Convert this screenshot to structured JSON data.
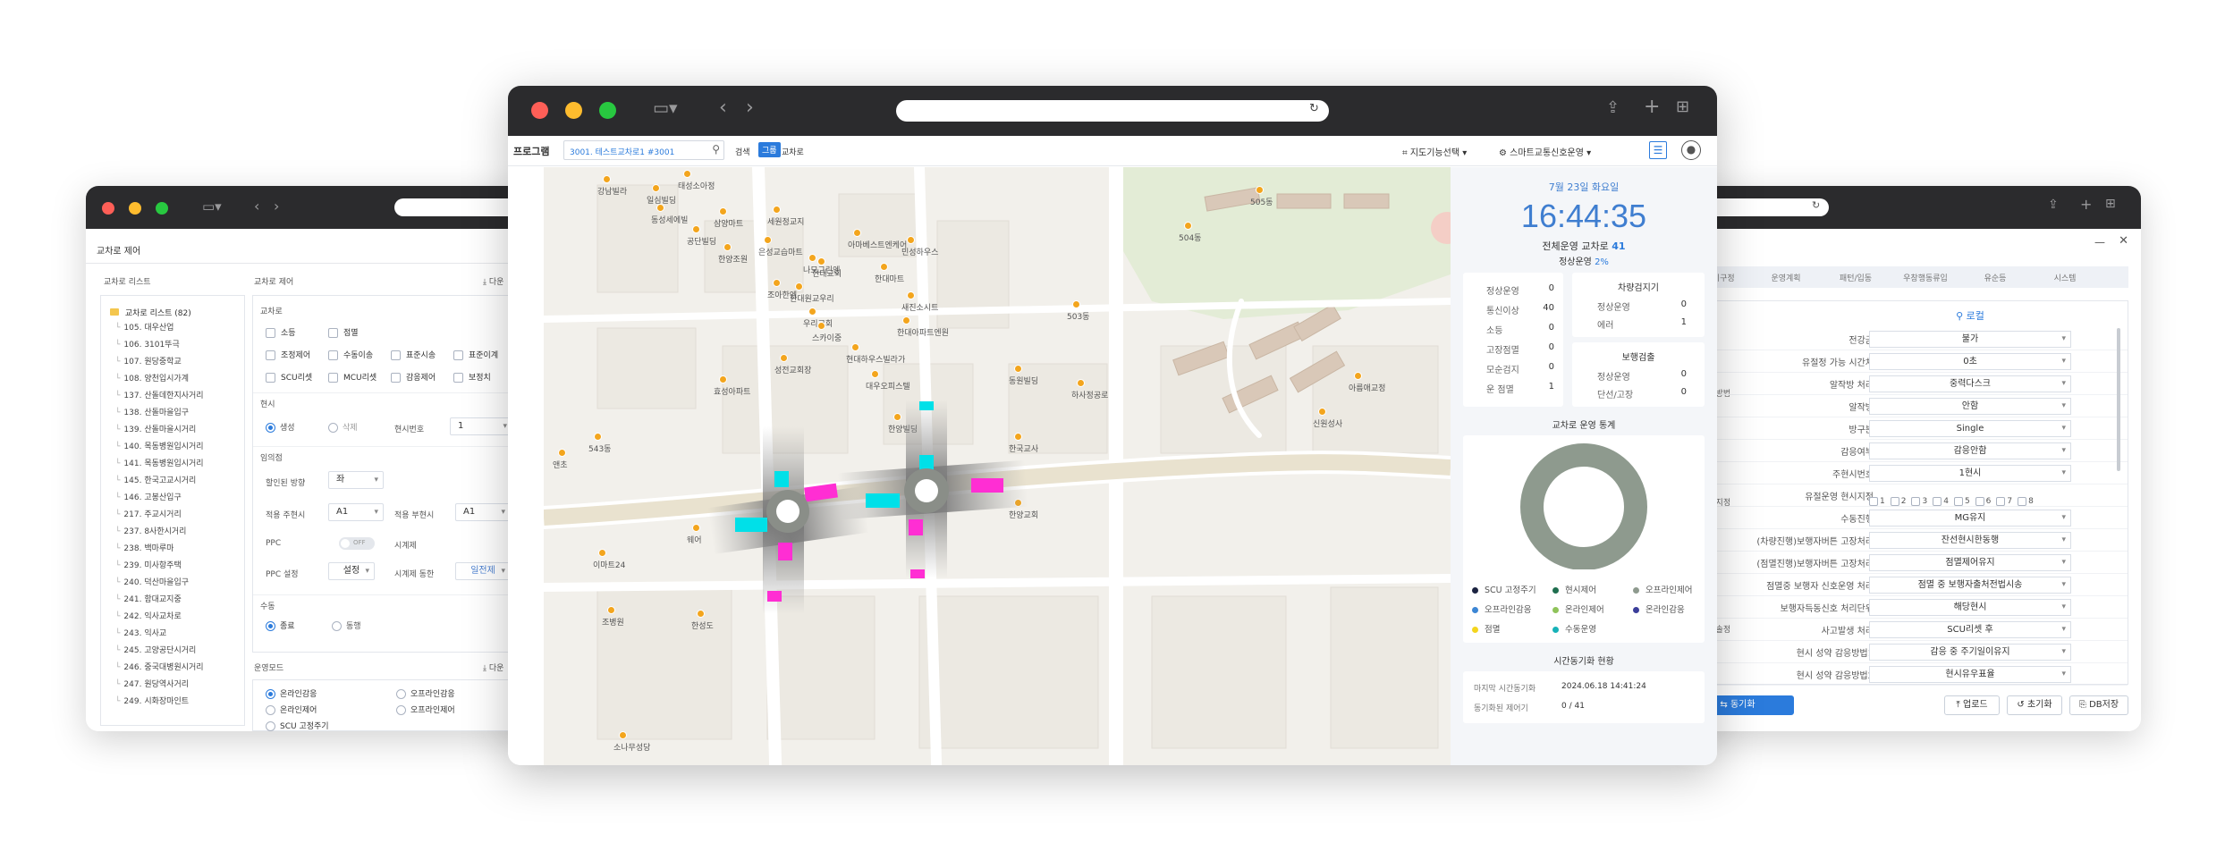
{
  "left_window": {
    "title": "교차로 제어",
    "tree_header": "교차로 리스트",
    "control_header": "교차로 제어",
    "download_label": "다운",
    "tree_root": "교차로 리스트 (82)",
    "tree_items": [
      "105. 대우산업",
      "106. 3101뚜극",
      "107. 원당중학교",
      "108. 양천입시가계",
      "137. 산돌데한지사거리",
      "138. 산돌마을입구",
      "139. 산돌마을시거리",
      "140. 목동병원입시거리",
      "141. 목동병원입시거리",
      "145. 한국고교시거리",
      "146. 고봉산입구",
      "217. 주교시거리",
      "237. 8사한시거리",
      "238. 백마루마",
      "239. 미사항주택",
      "240. 덕산마을입구",
      "241. 함대교지중",
      "242. 익사교차로",
      "243. 익사교",
      "245. 고양공단시거리",
      "246. 중국대병원시거리",
      "247. 원당역사거리",
      "249. 시화장마인트"
    ],
    "section_intersection": "교차로",
    "checks": [
      "소등",
      "점멸",
      "조정제어",
      "수동이송",
      "표준시송",
      "표준이계",
      "SCU리셋",
      "MCU리셋",
      "감응제어",
      "보정치"
    ],
    "section_time": "현시",
    "radio_gen": "생성",
    "radio_delete": "삭제",
    "phase_no_label": "현시번호",
    "phase_no_value": "1",
    "section_hold": "임의점",
    "speed_dir_label": "할인된 방향",
    "speed_dir_value": "좌",
    "apply_label": "적용 주현시",
    "apply_value": "A1",
    "apply2_label": "적용 부현시",
    "apply2_value": "A1",
    "ppc_label": "PPC",
    "ppc_toggle": "OFF",
    "timer_label": "시계제",
    "ppc_set_label": "PPC 설정",
    "ppc_set_value": "설정",
    "timer_sync_label": "시계제 동한",
    "timer_sync_value": "일전제",
    "section_manual": "수동",
    "radio_end": "종료",
    "radio_run": "동행",
    "section_mode": "운영모드",
    "download2_label": "다운",
    "mode_options": [
      "온라인감응",
      "오프라인감응",
      "온라인제어",
      "오프라인제어",
      "SCU 고정주기"
    ]
  },
  "center_window": {
    "program_label": "프로그램",
    "search_value": "3001. 테스트교차로1 #3001",
    "btn_search": "검색",
    "btn_group": "그룹",
    "btn_intersection": "교차로",
    "map_select": "지도기능선택",
    "smart_select": "스마트교통신호운영",
    "date": "7월 23일 화요일",
    "clock": "16:44:35",
    "total_label": "전체운영 교차로",
    "total_value": "41",
    "normal_label": "정상운영",
    "normal_value": "2%",
    "stats_left": [
      {
        "label": "정상운영",
        "value": "0"
      },
      {
        "label": "통신이상",
        "value": "40"
      },
      {
        "label": "소등",
        "value": "0"
      },
      {
        "label": "고장점멸",
        "value": "0"
      },
      {
        "label": "모순검지",
        "value": "0"
      },
      {
        "label": "운 점멸",
        "value": "1"
      }
    ],
    "stats_vehicle_title": "차량검지기",
    "stats_vehicle": [
      {
        "label": "정상운영",
        "value": "0"
      },
      {
        "label": "에러",
        "value": "1"
      }
    ],
    "stats_ped_title": "보행검출",
    "stats_ped": [
      {
        "label": "정상운영",
        "value": "0"
      },
      {
        "label": "단선/고장",
        "value": "0"
      }
    ],
    "chart_title": "교차로 운영 통계",
    "legend": [
      {
        "label": "SCU 고정주기",
        "color": "#1b2340"
      },
      {
        "label": "현시제어",
        "color": "#1f6e4f"
      },
      {
        "label": "오프라인제어",
        "color": "#8e9a8e"
      },
      {
        "label": "오프라인감응",
        "color": "#3c86d4"
      },
      {
        "label": "온라인제어",
        "color": "#8fc35a"
      },
      {
        "label": "온라인감응",
        "color": "#3b3e9a"
      },
      {
        "label": "점멸",
        "color": "#f4d51e"
      },
      {
        "label": "수동운영",
        "color": "#17b2b8"
      }
    ],
    "sync_title": "시간동기화 현황",
    "sync_last_label": "마지막 시간동기화",
    "sync_last_value": "2024.06.18 14:41:24",
    "sync_done_label": "동기화된 제어기",
    "sync_done_value": "0 / 41",
    "map_labels": [
      "강남빌라",
      "일심빌딩",
      "태성소아정",
      "동성세에빌",
      "삼양마트",
      "세원정교지",
      "공단빌딩",
      "은성교습마트",
      "한양조원",
      "아마베스트엔케어",
      "나모그린엔",
      "민성하우스",
      "조아한엔",
      "한대마트",
      "현대교회",
      "한대아파트엔원",
      "우리교회",
      "한대원교우리",
      "성전교회장",
      "새진소시트",
      "현대하우스빌라가",
      "스카이중",
      "효성아파트",
      "대우오피스텔",
      "동원빌딩",
      "한양빌딩",
      "하사정공로",
      "한국교사",
      "신원성사",
      "아름애교정",
      "한양교회",
      "이마트24",
      "웨어",
      "조병원",
      "한성도",
      "소나무성당",
      "앤초",
      "543동",
      "503동",
      "504동",
      "505동"
    ]
  },
  "right_window": {
    "tabs": [
      "표지기구정",
      "운영계획",
      "패턴/입동",
      "우창행동류입",
      "유순등",
      "시스템"
    ],
    "title": "로컬",
    "group_labels": [
      "운영방법",
      "현시지정",
      "통수솔정"
    ],
    "rows": [
      {
        "label": "전강금",
        "value": "불가"
      },
      {
        "label": "유절정 가능 시간차",
        "value": "0초"
      },
      {
        "label": "알작방 처리",
        "value": "중력다스크"
      },
      {
        "label": "알작방",
        "value": "안함"
      },
      {
        "label": "방구분",
        "value": "Single"
      },
      {
        "label": "감응여부",
        "value": "감응안함"
      },
      {
        "label": "주현시번호",
        "value": "1현시"
      },
      {
        "label": "유절운영 현시지정",
        "value": ""
      },
      {
        "label": "수동진행",
        "value": "MG유지"
      },
      {
        "label": "(차량진행)보행자버튼 고장처리",
        "value": "잔선현시한동행"
      },
      {
        "label": "(점멸진행)보행자버튼 고장처리",
        "value": "점멸제어유지"
      },
      {
        "label": "점멸중 보행자 신호운영 처리",
        "value": "점멸 중 보행자출처전법시송"
      },
      {
        "label": "보행자득동신호 처리단위",
        "value": "해당현시"
      },
      {
        "label": "사고발생 처리",
        "value": "SCU리셋 후"
      },
      {
        "label": "현시 성약 감응방법1",
        "value": "감응 중 주기일이유지"
      },
      {
        "label": "현시 성약 감응방법2",
        "value": "현시유우표율"
      }
    ],
    "phase_boxes": [
      "1",
      "2",
      "3",
      "4",
      "5",
      "6",
      "7",
      "8"
    ],
    "btn_sync": "동기화",
    "btn_upload": "업로드",
    "btn_reset": "초기화",
    "btn_db": "DB저장"
  }
}
